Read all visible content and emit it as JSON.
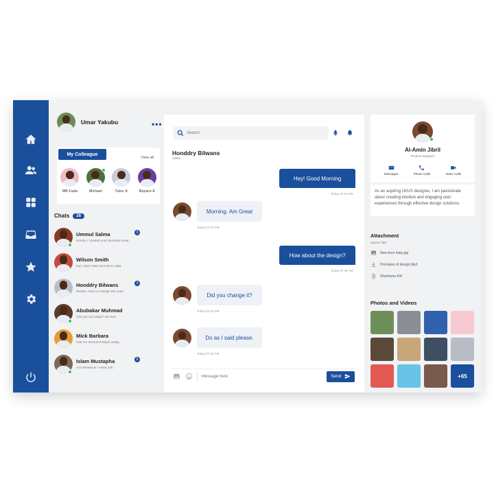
{
  "user": {
    "name": "Umar Yakubu"
  },
  "colleagues": {
    "tab_label": "My Colleague",
    "view_all": "View all",
    "items": [
      {
        "name": "MB Fada"
      },
      {
        "name": "Michael"
      },
      {
        "name": "Tukur K"
      },
      {
        "name": "Rejoice E"
      }
    ]
  },
  "chats": {
    "label": "Chats",
    "count": "28",
    "items": [
      {
        "name": "Ummul Salma",
        "preview": "Honey, I cooked your favourite meal",
        "badge": "3"
      },
      {
        "name": "Wilson Smith",
        "preview": "Hy! I don't have access to data",
        "badge": ""
      },
      {
        "name": "Honddry Bilwans",
        "preview": "Please, How to change the color",
        "badge": "3"
      },
      {
        "name": "Abubakar Muhmad",
        "preview": "Can you go today? am free",
        "badge": ""
      },
      {
        "name": "Mick Barbara",
        "preview": "Call me around 5:00pm today",
        "badge": ""
      },
      {
        "name": "Islam Mustapha",
        "preview": "Am freelancer I need Job.",
        "badge": "6"
      }
    ]
  },
  "conversation": {
    "search_placeholder": "Search",
    "contact_name": "Honddry Bilwans",
    "contact_status": "online",
    "messages": [
      {
        "text": "Hey! Good Morning",
        "time": "Today 07:16 PM"
      },
      {
        "text": "Morning. Am Great",
        "time": "Today 07:23 PM"
      },
      {
        "text": "How about the design?",
        "time": "Today 07:46 PM"
      },
      {
        "text": "Did you change it?",
        "time": "Today 07:53 PM"
      },
      {
        "text": "Do as I said please.",
        "time": "Today 07:56 PM"
      }
    ],
    "input_placeholder": "Message here",
    "send_label": "Send"
  },
  "profile": {
    "name": "Al-Amin Jibril",
    "role": "Product Designer",
    "actions": [
      "Messages",
      "Phone Calls",
      "Video Calls"
    ],
    "bio": "As an aspiring UI/UX designer, I am passionate about creating intuitive and engaging user experiences through effective design solutions."
  },
  "attachment": {
    "title": "Attachment",
    "subtitle": "Source files",
    "files": [
      "New born baby.jpg",
      "Principles of design.Mp3",
      "Wireframe.Pdf"
    ]
  },
  "media": {
    "title": "Photos and Videos",
    "more": "+65",
    "colors": [
      "#6f8f5a",
      "#8a8f95",
      "#2f61b0",
      "#f7c9d1",
      "#5b4a3a",
      "#c9a57a",
      "#3f4f63",
      "#b8bcc4",
      "#e25a55",
      "#69c3e6",
      "#7a5a4a"
    ]
  }
}
